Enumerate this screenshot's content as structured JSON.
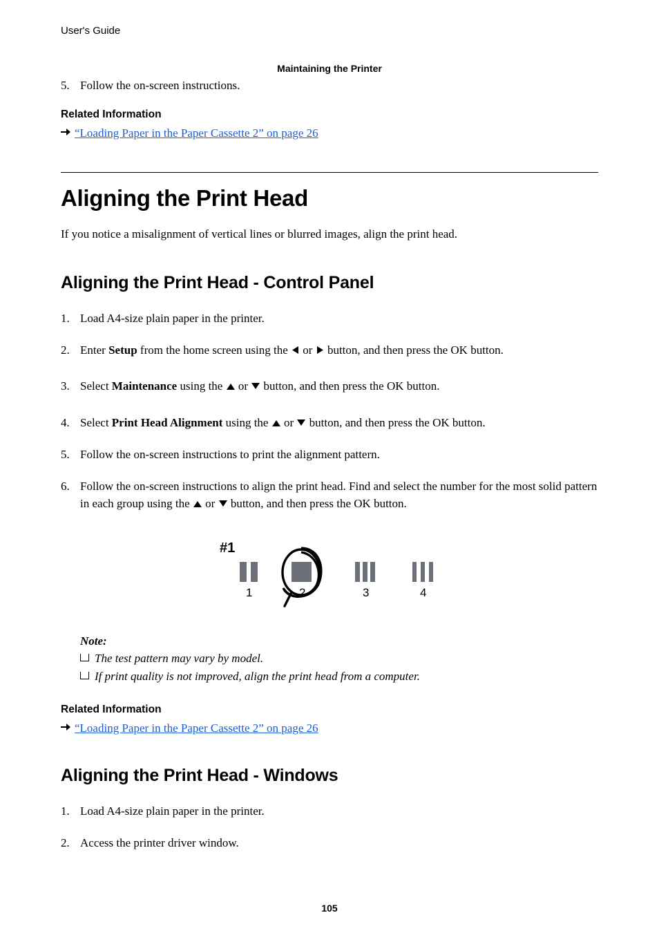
{
  "header": {
    "guide": "User's Guide",
    "section": "Maintaining the Printer"
  },
  "pretext": {
    "step5_num": "5.",
    "step5_text": "Follow the on-screen instructions."
  },
  "relinfo1": {
    "heading": "Related Information",
    "link_text": "“Loading Paper in the Paper Cassette 2” on page 26"
  },
  "h1": "Aligning the Print Head",
  "intro": "If you notice a misalignment of vertical lines or blurred images, align the print head.",
  "h2a": "Aligning the Print Head - Control Panel",
  "stepsA": {
    "s1_num": "1.",
    "s1_text": "Load A4-size plain paper in the printer.",
    "s2_num": "2.",
    "s2_pre": "Enter ",
    "s2_bold": "Setup",
    "s2_mid": " from the home screen using the ",
    "s2_or": " or ",
    "s2_post": " button, and then press the OK button.",
    "s3_num": "3.",
    "s3_pre": "Select ",
    "s3_bold": "Maintenance",
    "s3_mid": " using the ",
    "s3_or": " or ",
    "s3_post": " button, and then press the OK button.",
    "s4_num": "4.",
    "s4_pre": "Select ",
    "s4_bold": "Print Head Alignment",
    "s4_mid": " using the ",
    "s4_or": " or ",
    "s4_post": " button, and then press the OK button.",
    "s5_num": "5.",
    "s5_text": "Follow the on-screen instructions to print the alignment pattern.",
    "s6_num": "6.",
    "s6_a": "Follow the on-screen instructions to align the print head. Find and select the number for the most solid pattern in each group using the ",
    "s6_or": " or ",
    "s6_b": " button, and then press the OK button."
  },
  "figure": {
    "label": "#1",
    "nums": {
      "n1": "1",
      "n2": "2",
      "n3": "3",
      "n4": "4"
    }
  },
  "note": {
    "title": "Note:",
    "i1": "The test pattern may vary by model.",
    "i2": "If print quality is not improved, align the print head from a computer."
  },
  "relinfo2": {
    "heading": "Related Information",
    "link_text": "“Loading Paper in the Paper Cassette 2” on page 26"
  },
  "h2b": "Aligning the Print Head - Windows",
  "stepsB": {
    "s1_num": "1.",
    "s1_text": "Load A4-size plain paper in the printer.",
    "s2_num": "2.",
    "s2_text": "Access the printer driver window."
  },
  "pageNumber": "105"
}
